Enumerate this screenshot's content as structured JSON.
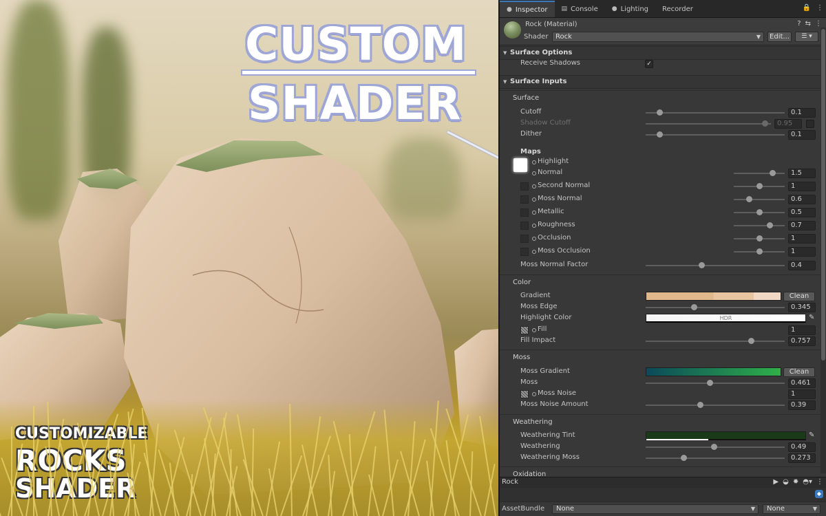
{
  "overlay": {
    "title_line1": "CUSTOM",
    "title_line2": "SHADER",
    "badge_line1": "CUSTOMIZABLE",
    "badge_line2": "ROCKS",
    "badge_line3": "SHADER"
  },
  "tabs": [
    {
      "label": "Inspector",
      "icon": "info-icon",
      "active": true
    },
    {
      "label": "Console",
      "icon": "console-icon",
      "active": false
    },
    {
      "label": "Lighting",
      "icon": "bulb-icon",
      "active": false
    },
    {
      "label": "Recorder",
      "icon": "",
      "active": false
    }
  ],
  "material": {
    "name": "Rock (Material)",
    "shader_label": "Shader",
    "shader_value": "Rock",
    "edit_label": "Edit...",
    "list_glyph": "☰"
  },
  "surface_options": {
    "header": "Surface Options",
    "receive_shadows_label": "Receive Shadows",
    "receive_shadows": true
  },
  "surface_inputs": {
    "header": "Surface Inputs",
    "surface_label": "Surface",
    "cutoff": {
      "label": "Cutoff",
      "value": "0.1",
      "level": 0.1
    },
    "shadow_cutoff": {
      "label": "Shadow Cutoff",
      "value": "0.95",
      "level": 0.95
    },
    "dither": {
      "label": "Dither",
      "value": "0.1",
      "level": 0.1
    },
    "maps_label": "Maps",
    "highlight_label": "Highlight",
    "maps": [
      {
        "label": "Normal",
        "value": "1.5",
        "level": 0.75
      },
      {
        "label": "Second Normal",
        "value": "1",
        "level": 0.5
      },
      {
        "label": "Moss Normal",
        "value": "0.6",
        "level": 0.3
      },
      {
        "label": "Metallic",
        "value": "0.5",
        "level": 0.5
      },
      {
        "label": "Roughness",
        "value": "0.7",
        "level": 0.7
      },
      {
        "label": "Occlusion",
        "value": "1",
        "level": 0.5
      },
      {
        "label": "Moss Occlusion",
        "value": "1",
        "level": 0.5
      }
    ],
    "moss_normal_factor": {
      "label": "Moss Normal Factor",
      "value": "0.4",
      "level": 0.4
    }
  },
  "color_section": {
    "label": "Color",
    "gradient_label": "Gradient",
    "clean_label": "Clean",
    "gradient_colors": [
      "#e0b88c",
      "#e8c4a0",
      "#f0d8c4"
    ],
    "moss_edge": {
      "label": "Moss Edge",
      "value": "0.345",
      "level": 0.345
    },
    "highlight_color_label": "Highlight Color",
    "hdr_label": "HDR",
    "fill_label": "Fill",
    "fill_value": "1",
    "fill_impact": {
      "label": "Fill Impact",
      "value": "0.757",
      "level": 0.757
    }
  },
  "moss_section": {
    "label": "Moss",
    "moss_gradient_label": "Moss Gradient",
    "clean_label": "Clean",
    "gradient_colors": [
      "#0b4a5a",
      "#2fb04a"
    ],
    "moss": {
      "label": "Moss",
      "value": "0.461",
      "level": 0.461
    },
    "moss_noise_label": "Moss Noise",
    "moss_noise_value": "1",
    "moss_noise_amount": {
      "label": "Moss Noise Amount",
      "value": "0.39",
      "level": 0.39
    }
  },
  "weathering_section": {
    "label": "Weathering",
    "tint_label": "Weathering Tint",
    "tint_color": "#1a3a1a",
    "weathering": {
      "label": "Weathering",
      "value": "0.49",
      "level": 0.49
    },
    "weathering_moss": {
      "label": "Weathering Moss",
      "value": "0.273",
      "level": 0.273
    }
  },
  "oxidation_label": "Oxidation",
  "bottom": {
    "preview_label": "Rock",
    "assetbundle_label": "AssetBundle",
    "assetbundle_value": "None",
    "variant_value": "None"
  },
  "colors": {
    "accent": "#3a79bb",
    "panel_bg": "#383838"
  }
}
